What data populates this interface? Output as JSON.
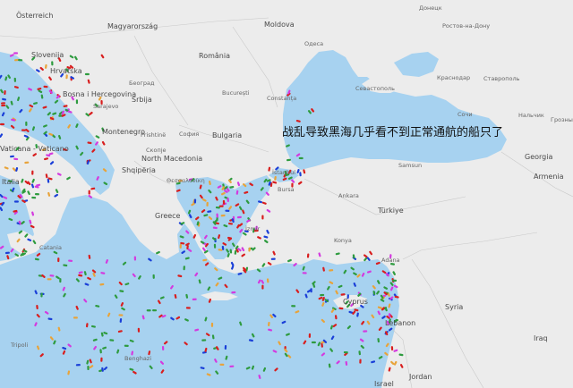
{
  "overlay_caption": "战乱导致黑海几乎看不到正常通航的船只了",
  "labels": {
    "osterreich": "Österreich",
    "magyarorszag": "Magyarország",
    "romania": "România",
    "moldova": "Moldova",
    "slovenija": "Slovenija",
    "hrvatska": "Hrvatska",
    "bosna": "Bosna i Hercegovina",
    "beograd": "Београд",
    "srbija": "Srbija",
    "sarajevo": "Sarajevo",
    "bucuresti": "București",
    "montenegro": "Montenegro",
    "pristine": "Prishtinë",
    "sofia": "София",
    "bulgaria": "Bulgaria",
    "skopje": "Скопје",
    "north_macedonia": "North Macedonia",
    "shqiperia": "Shqipëria",
    "thessaloniki": "Θεσσαλονίκη",
    "greece": "Greece",
    "vaticana": "Vaticana - Vaticano",
    "italia": "Italia",
    "catania": "Catania",
    "tripoli": "Tripoli",
    "benghazi": "Benghazi",
    "donetsk": "Донецк",
    "odesa": "Одеса",
    "rostov": "Ростов-на-Дону",
    "krasnodar": "Краснодар",
    "stavropol": "Ставрополь",
    "sevastopol": "Севастополь",
    "sochi": "Сочи",
    "nalchik": "Нальчик",
    "groznyy": "Грозны",
    "constanta": "Constanța",
    "istanbul": "İstanbul",
    "bursa": "Bursa",
    "samsun": "Samsun",
    "ankara": "Ankara",
    "turkiye": "Türkiye",
    "georgia": "Georgia",
    "armenia": "Armenia",
    "izmir": "İzmir",
    "konya": "Konya",
    "adana": "Adana",
    "cyprus": "Cyprus",
    "lebanon": "Lebanon",
    "syria": "Syria",
    "iraq": "Iraq",
    "israel": "Israel",
    "jordan": "Jordan"
  },
  "vessel_colors": {
    "cargo": "#2e9b3f",
    "tanker": "#d81e1e",
    "passenger": "#1a3fd8",
    "other": "#d43adf",
    "fishing": "#e8a33a"
  },
  "water_color": "#a7d2f0",
  "land_color": "#ececec"
}
